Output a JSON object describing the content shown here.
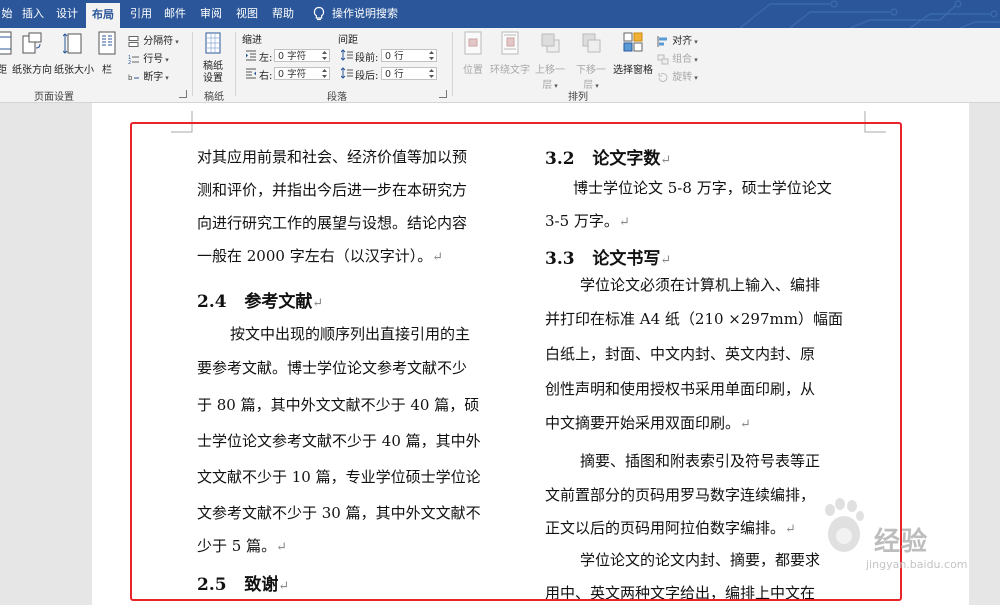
{
  "tabs": [
    {
      "label": "始",
      "active": false
    },
    {
      "label": "插入",
      "active": false
    },
    {
      "label": "设计",
      "active": false
    },
    {
      "label": "布局",
      "active": true
    },
    {
      "label": "引用",
      "active": false
    },
    {
      "label": "邮件",
      "active": false
    },
    {
      "label": "审阅",
      "active": false
    },
    {
      "label": "视图",
      "active": false
    },
    {
      "label": "帮助",
      "active": false
    }
  ],
  "tell_me": "操作说明搜索",
  "ribbon": {
    "page_setup": {
      "margins": "距",
      "orientation": "纸张方向",
      "size": "纸张大小",
      "columns": "栏",
      "breaks": "分隔符",
      "line_numbers": "行号",
      "hyphenation": "断字",
      "group": "页面设置"
    },
    "draft": {
      "paper_settings": "稿纸\n设置",
      "group": "稿纸"
    },
    "paragraph": {
      "indent_title": "缩进",
      "spacing_title": "间距",
      "left_label": "左:",
      "left_value": "0 字符",
      "right_label": "右:",
      "right_value": "0 字符",
      "before_label": "段前:",
      "before_value": "0 行",
      "after_label": "段后:",
      "after_value": "0 行",
      "group": "段落"
    },
    "arrange": {
      "position": "位置",
      "wrap_text": "环绕文字",
      "bring_forward": "上移一层",
      "send_backward": "下移一层",
      "selection_pane": "选择窗格",
      "align": "对齐",
      "group_btn": "组合",
      "rotate": "旋转",
      "group": "排列"
    }
  },
  "document": {
    "left_column": {
      "p1": [
        "对其应用前景和社会、经济价值等加以预",
        "测和评价，并指出今后进一步在本研究方",
        "向进行研究工作的展望与设想。结论内容",
        "一般在 2000 字左右（以汉字计）。"
      ],
      "h24_num": "2.4",
      "h24_text": "参考文献",
      "p2": [
        "按文中出现的顺序列出直接引用的主",
        "要参考文献。博士学位论文参考文献不少",
        "于 80 篇，其中外文文献不少于 40 篇，硕",
        "士学位论文参考文献不少于 40 篇，其中外",
        "文文献不少于 10 篇，专业学位硕士学位论",
        "文参考文献不少于 30 篇，其中外文文献不",
        "少于 5 篇。"
      ],
      "h25_num": "2.5",
      "h25_text": "致谢"
    },
    "right_column": {
      "h32_num": "3.2",
      "h32_text": "论文字数",
      "p1": [
        "博士学位论文 5-8 万字，硕士学位论文",
        "3-5 万字。"
      ],
      "h33_num": "3.3",
      "h33_text": "论文书写",
      "p2": [
        "学位论文必须在计算机上输入、编排",
        "并打印在标准 A4 纸（210 ×297mm）幅面",
        "白纸上，封面、中文内封、英文内封、原",
        "创性声明和使用授权书采用单面印刷，从",
        "中文摘要开始采用双面印刷。"
      ],
      "p3": [
        "摘要、插图和附表索引及符号表等正",
        "文前置部分的页码用罗马数字连续编排，",
        "正文以后的页码用阿拉伯数字编排。"
      ],
      "p4": [
        "学位论文的论文内封、摘要，都要求",
        "用中、英文两种文字给出，编排上中文在"
      ]
    },
    "paragraph_mark": "↵"
  },
  "watermark": {
    "text": "经验",
    "url": "jingyan.baidu.com"
  },
  "colors": {
    "ribbon_blue": "#2b579a",
    "highlight_red": "#e8232a"
  }
}
